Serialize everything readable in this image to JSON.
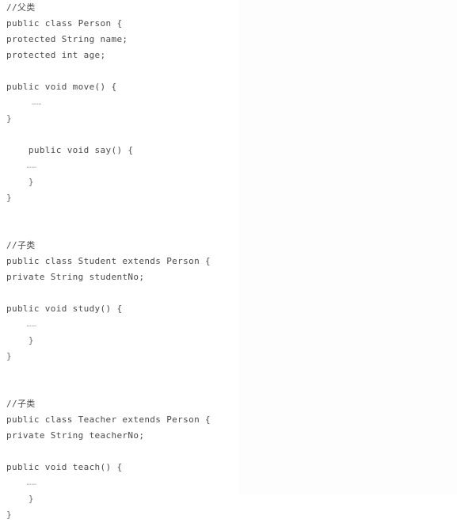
{
  "document": {
    "type": "code-listing",
    "language": "Java",
    "background_color": "#ffffff",
    "text_color": "#4a4a4a",
    "muted_color": "#b8b8b8",
    "lines": [
      {
        "text": "//父类",
        "kind": "comment"
      },
      {
        "text": "public class Person {",
        "kind": "code"
      },
      {
        "text": "protected String name;",
        "kind": "code"
      },
      {
        "text": "protected int age;",
        "kind": "code"
      },
      {
        "text": "",
        "kind": "blank"
      },
      {
        "text": "public void move() {",
        "kind": "code"
      },
      {
        "text": "     ……",
        "kind": "ellipsis"
      },
      {
        "text": "}",
        "kind": "brace"
      },
      {
        "text": "",
        "kind": "blank"
      },
      {
        "text": "    public void say() {",
        "kind": "code"
      },
      {
        "text": "    ……",
        "kind": "ellipsis"
      },
      {
        "text": "    }",
        "kind": "brace"
      },
      {
        "text": "}",
        "kind": "brace"
      },
      {
        "text": "",
        "kind": "blank"
      },
      {
        "text": "",
        "kind": "blank"
      },
      {
        "text": "//子类",
        "kind": "comment"
      },
      {
        "text": "public class Student extends Person {",
        "kind": "code"
      },
      {
        "text": "private String studentNo;",
        "kind": "code"
      },
      {
        "text": "",
        "kind": "blank"
      },
      {
        "text": "public void study() {",
        "kind": "code"
      },
      {
        "text": "    ……",
        "kind": "ellipsis"
      },
      {
        "text": "    }",
        "kind": "brace"
      },
      {
        "text": "}",
        "kind": "brace"
      },
      {
        "text": "",
        "kind": "blank"
      },
      {
        "text": "",
        "kind": "blank"
      },
      {
        "text": "//子类",
        "kind": "comment"
      },
      {
        "text": "public class Teacher extends Person {",
        "kind": "code"
      },
      {
        "text": "private String teacherNo;",
        "kind": "code"
      },
      {
        "text": "",
        "kind": "blank"
      },
      {
        "text": "public void teach() {",
        "kind": "code"
      },
      {
        "text": "    ……",
        "kind": "ellipsis"
      },
      {
        "text": "    }",
        "kind": "brace"
      },
      {
        "text": "}",
        "kind": "brace"
      }
    ]
  }
}
